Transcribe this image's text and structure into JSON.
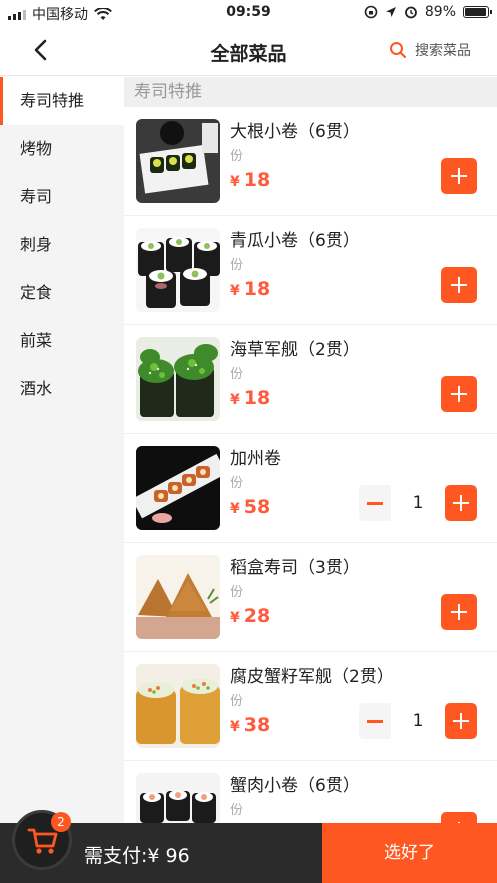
{
  "status_bar": {
    "carrier": "中国移动",
    "time": "09:59",
    "battery": "89%"
  },
  "nav": {
    "title": "全部菜品",
    "search_placeholder": "搜索菜品"
  },
  "sidebar": {
    "items": [
      {
        "label": "寿司特推",
        "active": true
      },
      {
        "label": "烤物"
      },
      {
        "label": "寿司"
      },
      {
        "label": "刺身"
      },
      {
        "label": "定食"
      },
      {
        "label": "前菜"
      },
      {
        "label": "酒水"
      }
    ]
  },
  "category_header": "寿司特推",
  "currency": "¥",
  "items": [
    {
      "name": "大根小卷（6贯）",
      "unit": "份",
      "price": "18"
    },
    {
      "name": "青瓜小卷（6贯）",
      "unit": "份",
      "price": "18"
    },
    {
      "name": "海草军舰（2贯）",
      "unit": "份",
      "price": "18"
    },
    {
      "name": "加州卷",
      "unit": "份",
      "price": "58",
      "qty": "1"
    },
    {
      "name": "稻盒寿司（3贯）",
      "unit": "份",
      "price": "28"
    },
    {
      "name": "腐皮蟹籽军舰（2贯）",
      "unit": "份",
      "price": "38",
      "qty": "1"
    },
    {
      "name": "蟹肉小卷（6贯）",
      "unit": "份",
      "price": ""
    }
  ],
  "cart": {
    "count": "2",
    "pay_label": "需支付:",
    "total": "¥ 96",
    "confirm_label": "选好了"
  },
  "colors": {
    "accent": "#ff5722",
    "price": "#ff5a3c",
    "bottom_bar": "#2b2b2b"
  },
  "icons": [
    "back-arrow-icon",
    "search-icon",
    "cart-icon",
    "plus-icon",
    "minus-icon",
    "wifi-icon",
    "alarm-icon",
    "location-icon",
    "lock-rotation-icon"
  ]
}
